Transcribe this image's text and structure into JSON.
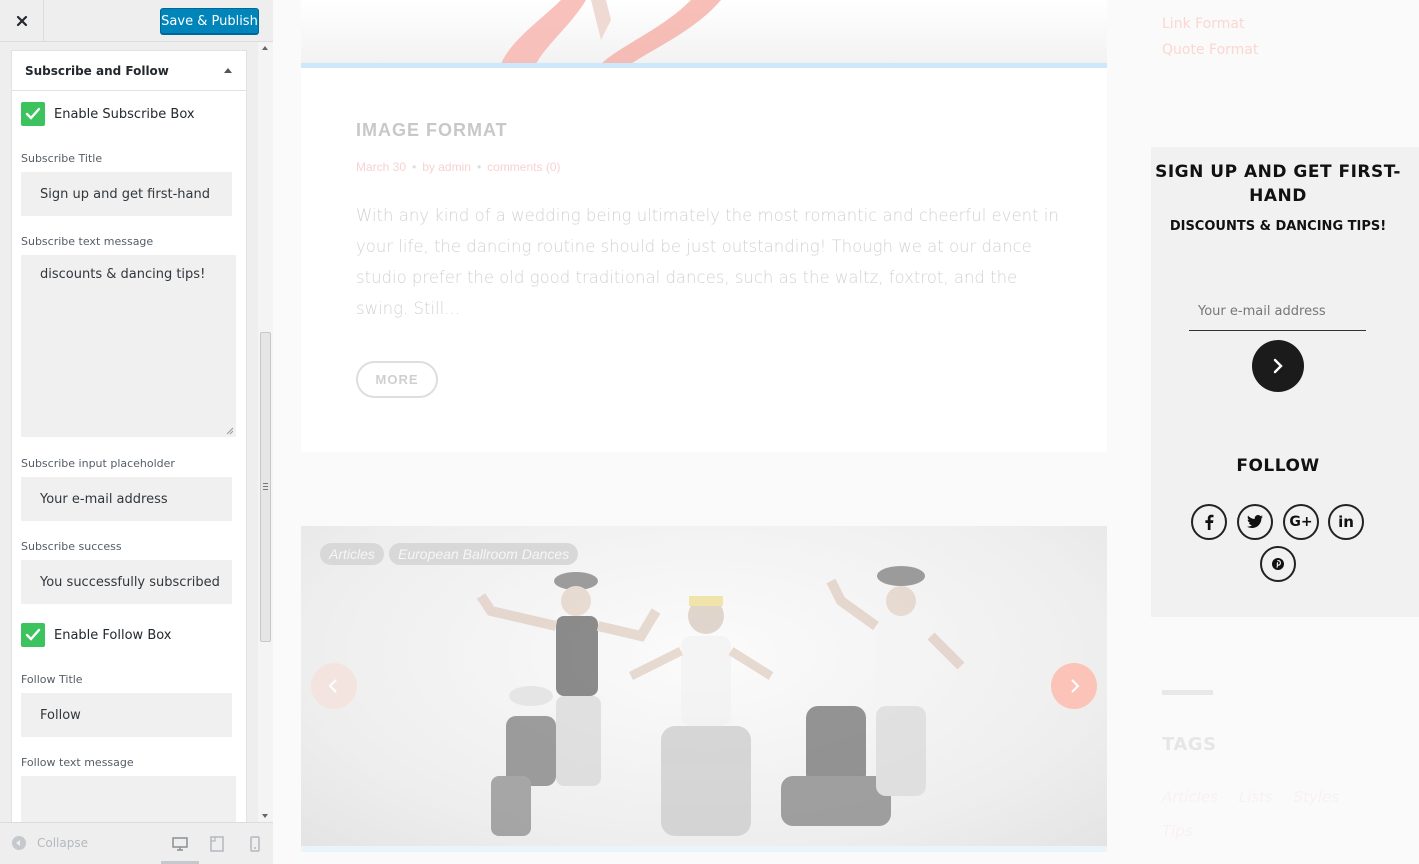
{
  "customizer": {
    "close_label": "×",
    "save_label": "Save & Publish",
    "section_title": "Subscribe and Follow",
    "enable_subscribe_label": "Enable Subscribe Box",
    "enable_subscribe_checked": true,
    "subscribe_title_label": "Subscribe Title",
    "subscribe_title_value": "Sign up and get first-hand",
    "subscribe_text_label": "Subscribe text message",
    "subscribe_text_value": "discounts & dancing tips!",
    "subscribe_placeholder_label": "Subscribe input placeholder",
    "subscribe_placeholder_value": "Your e-mail address",
    "subscribe_success_label": "Subscribe success",
    "subscribe_success_value": "You successfully subscribed",
    "enable_follow_label": "Enable Follow Box",
    "enable_follow_checked": true,
    "follow_title_label": "Follow Title",
    "follow_title_value": "Follow",
    "follow_text_label": "Follow text message",
    "follow_text_value": "",
    "collapse_label": "Collapse",
    "accent_color": "#0085ba",
    "check_color": "#3cc35e"
  },
  "preview": {
    "post": {
      "title": "IMAGE FORMAT",
      "date": "March 30",
      "author": "by admin",
      "comments": "comments (0)",
      "excerpt": "With any kind of a wedding being ultimately the most romantic and cheerful event in your life, the dancing routine should be just outstanding! Though we at our dance studio prefer the old good traditional dances, such as the waltz, foxtrot, and the swing. Still...",
      "more_label": "MORE"
    },
    "gallery": {
      "tags": [
        "Articles",
        "European Ballroom Dances"
      ],
      "prev_icon": "chevron-left-icon",
      "next_icon": "chevron-right-icon"
    },
    "side_links": [
      "Link Format",
      "Quote Format"
    ],
    "subscribe_widget": {
      "title": "SIGN UP AND GET FIRST-HAND",
      "text": "DISCOUNTS & DANCING TIPS!",
      "placeholder": "Your e-mail address",
      "follow_title": "FOLLOW",
      "socials": [
        "facebook-icon",
        "twitter-icon",
        "google-plus-icon",
        "linkedin-icon",
        "pinterest-icon"
      ],
      "google_plus_glyph": "G+",
      "linkedin_glyph": "in"
    },
    "tags_widget": {
      "title": "TAGS",
      "items": [
        "Articles",
        "Lists",
        "Styles",
        "Tips"
      ]
    }
  }
}
